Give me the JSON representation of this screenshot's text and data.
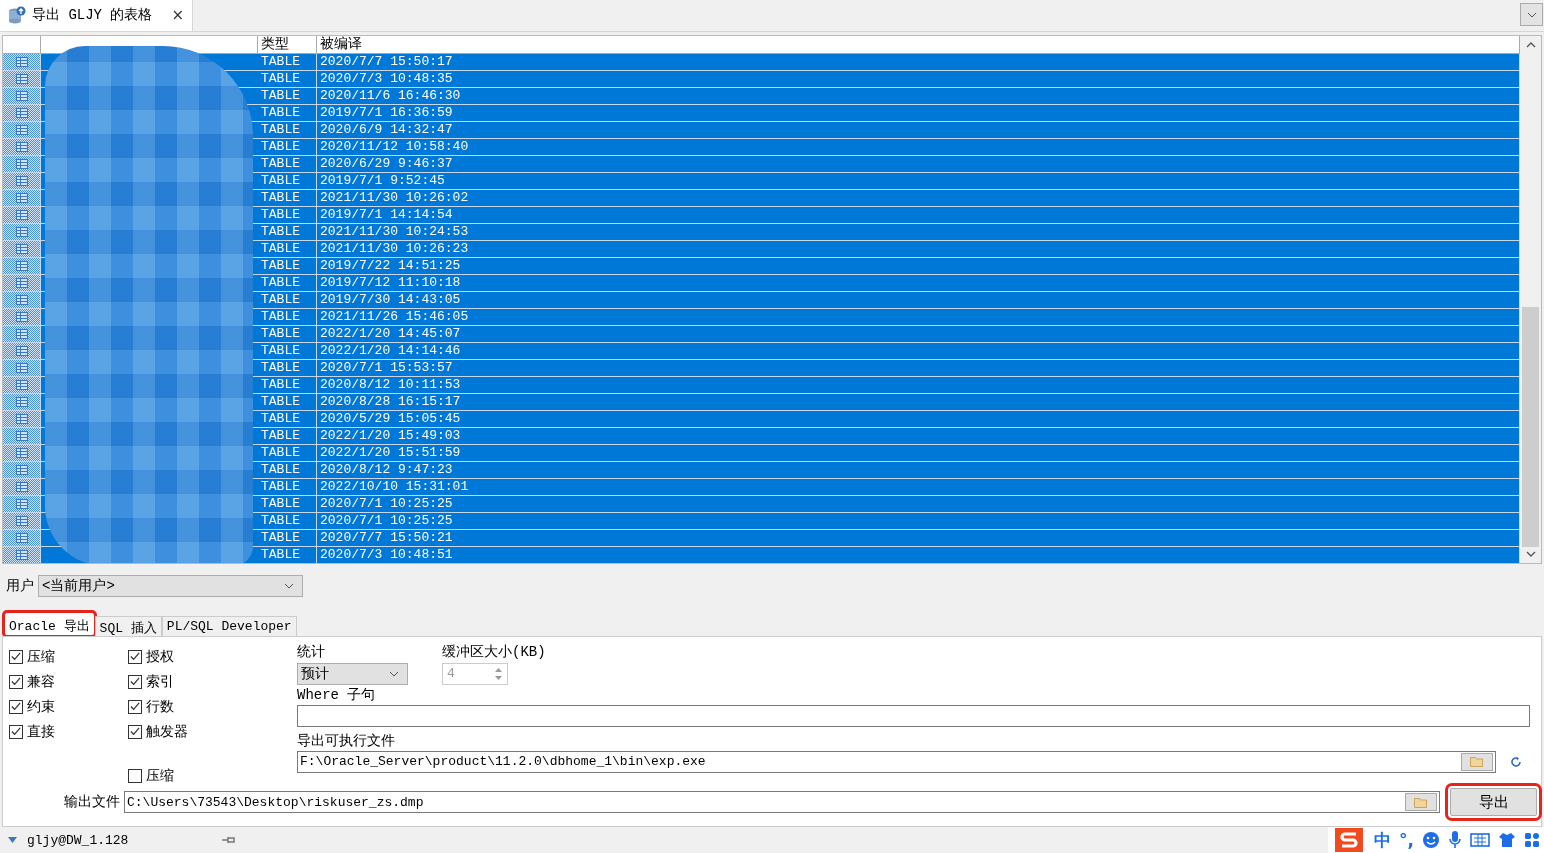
{
  "window_tab": {
    "title": "导出 GLJY 的表格",
    "close": "×"
  },
  "table": {
    "columns": [
      "类型",
      "被编译"
    ],
    "rows": [
      {
        "type": "TABLE",
        "compiled": "2020/7/7 15:50:17",
        "selected": true
      },
      {
        "type": "TABLE",
        "compiled": "2020/7/3 10:48:35",
        "selected": true
      },
      {
        "type": "TABLE",
        "compiled": "2020/11/6 16:46:30",
        "selected": true
      },
      {
        "type": "TABLE",
        "compiled": "2019/7/1 16:36:59",
        "selected": true
      },
      {
        "type": "TABLE",
        "compiled": "2020/6/9 14:32:47",
        "selected": true
      },
      {
        "type": "TABLE",
        "compiled": "2020/11/12 10:58:40",
        "selected": true
      },
      {
        "type": "TABLE",
        "compiled": "2020/6/29 9:46:37",
        "selected": true
      },
      {
        "type": "TABLE",
        "compiled": "2019/7/1 9:52:45",
        "selected": true
      },
      {
        "type": "TABLE",
        "compiled": "2021/11/30 10:26:02",
        "selected": true
      },
      {
        "type": "TABLE",
        "compiled": "2019/7/1 14:14:54",
        "selected": true
      },
      {
        "type": "TABLE",
        "compiled": "2021/11/30 10:24:53",
        "selected": true
      },
      {
        "type": "TABLE",
        "compiled": "2021/11/30 10:26:23",
        "selected": true
      },
      {
        "type": "TABLE",
        "compiled": "2019/7/22 14:51:25",
        "selected": true
      },
      {
        "type": "TABLE",
        "compiled": "2019/7/12 11:10:18",
        "selected": true
      },
      {
        "type": "TABLE",
        "compiled": "2019/7/30 14:43:05",
        "selected": true
      },
      {
        "type": "TABLE",
        "compiled": "2021/11/26 15:46:05",
        "selected": true
      },
      {
        "type": "TABLE",
        "compiled": "2022/1/20 14:45:07",
        "selected": true
      },
      {
        "type": "TABLE",
        "compiled": "2022/1/20 14:14:46",
        "selected": true
      },
      {
        "type": "TABLE",
        "compiled": "2020/7/1 15:53:57",
        "selected": true
      },
      {
        "type": "TABLE",
        "compiled": "2020/8/12 10:11:53",
        "selected": true
      },
      {
        "type": "TABLE",
        "compiled": "2020/8/28 16:15:17",
        "selected": true
      },
      {
        "type": "TABLE",
        "compiled": "2020/5/29 15:05:45",
        "selected": true
      },
      {
        "type": "TABLE",
        "compiled": "2022/1/20 15:49:03",
        "selected": true
      },
      {
        "type": "TABLE",
        "compiled": "2022/1/20 15:51:59",
        "selected": true
      },
      {
        "type": "TABLE",
        "compiled": "2020/8/12 9:47:23",
        "selected": true
      },
      {
        "type": "TABLE",
        "compiled": "2022/10/10 15:31:01",
        "selected": true
      },
      {
        "type": "TABLE",
        "compiled": "2020/7/1 10:25:25",
        "selected": true
      },
      {
        "type": "TABLE",
        "compiled": "2020/7/1 10:25:25",
        "selected": true
      },
      {
        "type": "TABLE",
        "compiled": "2020/7/7 15:50:21",
        "selected": true
      },
      {
        "type": "TABLE",
        "compiled": "2020/7/3 10:48:51",
        "selected": true
      }
    ]
  },
  "user": {
    "label": "用户",
    "value": "<当前用户>"
  },
  "export_tabs": [
    {
      "label": "Oracle 导出",
      "selected": true,
      "highlighted": true
    },
    {
      "label": "SQL 插入",
      "selected": false,
      "highlighted": false
    },
    {
      "label": "PL/SQL Developer",
      "selected": false,
      "highlighted": false
    }
  ],
  "options_left": [
    {
      "label": "压缩",
      "checked": true
    },
    {
      "label": "兼容",
      "checked": true
    },
    {
      "label": "约束",
      "checked": true
    },
    {
      "label": "直接",
      "checked": true
    }
  ],
  "options_right": [
    {
      "label": "授权",
      "checked": true
    },
    {
      "label": "索引",
      "checked": true
    },
    {
      "label": "行数",
      "checked": true
    },
    {
      "label": "触发器",
      "checked": true
    }
  ],
  "extra_option": {
    "label": "压缩",
    "checked": false
  },
  "statistics": {
    "label": "统计",
    "value": "预计"
  },
  "buffer": {
    "label": "缓冲区大小(KB)",
    "value": "4",
    "disabled": true
  },
  "where": {
    "label": "Where 子句"
  },
  "executable": {
    "label": "导出可执行文件",
    "value": "F:\\Oracle_Server\\product\\11.2.0\\dbhome_1\\bin\\exp.exe"
  },
  "output_file": {
    "label": "输出文件",
    "value": "C:\\Users\\73543\\Desktop\\riskuser_zs.dmp"
  },
  "export_button": {
    "label": "导出",
    "highlighted": true
  },
  "status_bar": {
    "connection": "gljy@DW_1.128"
  },
  "ime_toolbar": {
    "items": [
      "中",
      "°,"
    ]
  }
}
